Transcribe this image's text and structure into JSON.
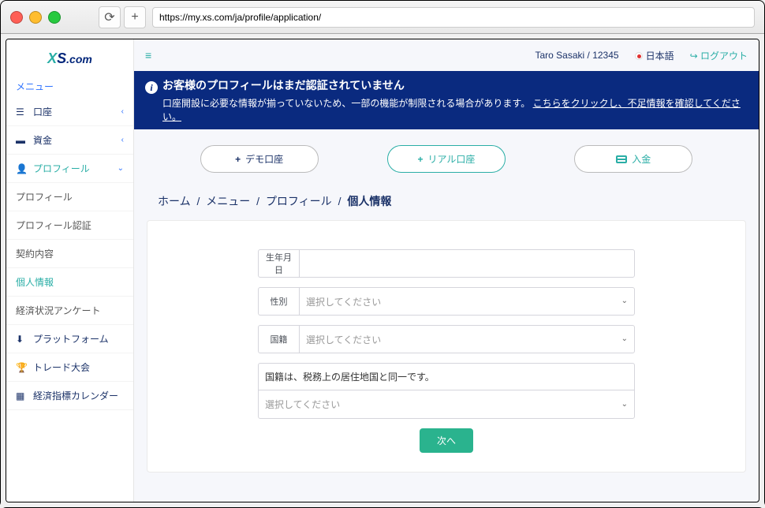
{
  "browser": {
    "url": "https://my.xs.com/ja/profile/application/"
  },
  "logo": {
    "x": "X",
    "s": "S",
    "dotcom": ".com"
  },
  "sidebar": {
    "menu_title": "メニュー",
    "items": [
      {
        "icon": "list",
        "label": "口座",
        "chev": "‹"
      },
      {
        "icon": "briefcase",
        "label": "資金",
        "chev": "‹"
      },
      {
        "icon": "user",
        "label": "プロフィール",
        "chev": "⌄",
        "active": true
      }
    ],
    "subs": [
      {
        "label": "プロフィール"
      },
      {
        "label": "プロフィール認証"
      },
      {
        "label": "契約内容"
      },
      {
        "label": "個人情報",
        "current": true
      },
      {
        "label": "経済状況アンケート"
      }
    ],
    "extra": [
      {
        "icon": "download",
        "label": "プラットフォーム"
      },
      {
        "icon": "trophy",
        "label": "トレード大会"
      },
      {
        "icon": "calendar",
        "label": "経済指標カレンダー"
      }
    ]
  },
  "topbar": {
    "user": "Taro Sasaki / 12345",
    "language": "日本語",
    "logout": "ログアウト"
  },
  "banner": {
    "title": "お客様のプロフィールはまだ認証されていません",
    "desc": "口座開設に必要な情報が揃っていないため、一部の機能が制限される場合があります。",
    "link": "こちらをクリックし、不足情報を確認してください。"
  },
  "actions": {
    "demo": "デモ口座",
    "real": "リアル口座",
    "deposit": "入金"
  },
  "breadcrumb": {
    "home": "ホーム",
    "menu": "メニュー",
    "profile": "プロフィール",
    "current": "個人情報",
    "sep": "/"
  },
  "form": {
    "dob_label": "生年月日",
    "gender_label": "性別",
    "nationality_label": "国籍",
    "select_placeholder": "選択してください",
    "note": "国籍は、税務上の居住地国と同一です。",
    "next": "次へ"
  }
}
